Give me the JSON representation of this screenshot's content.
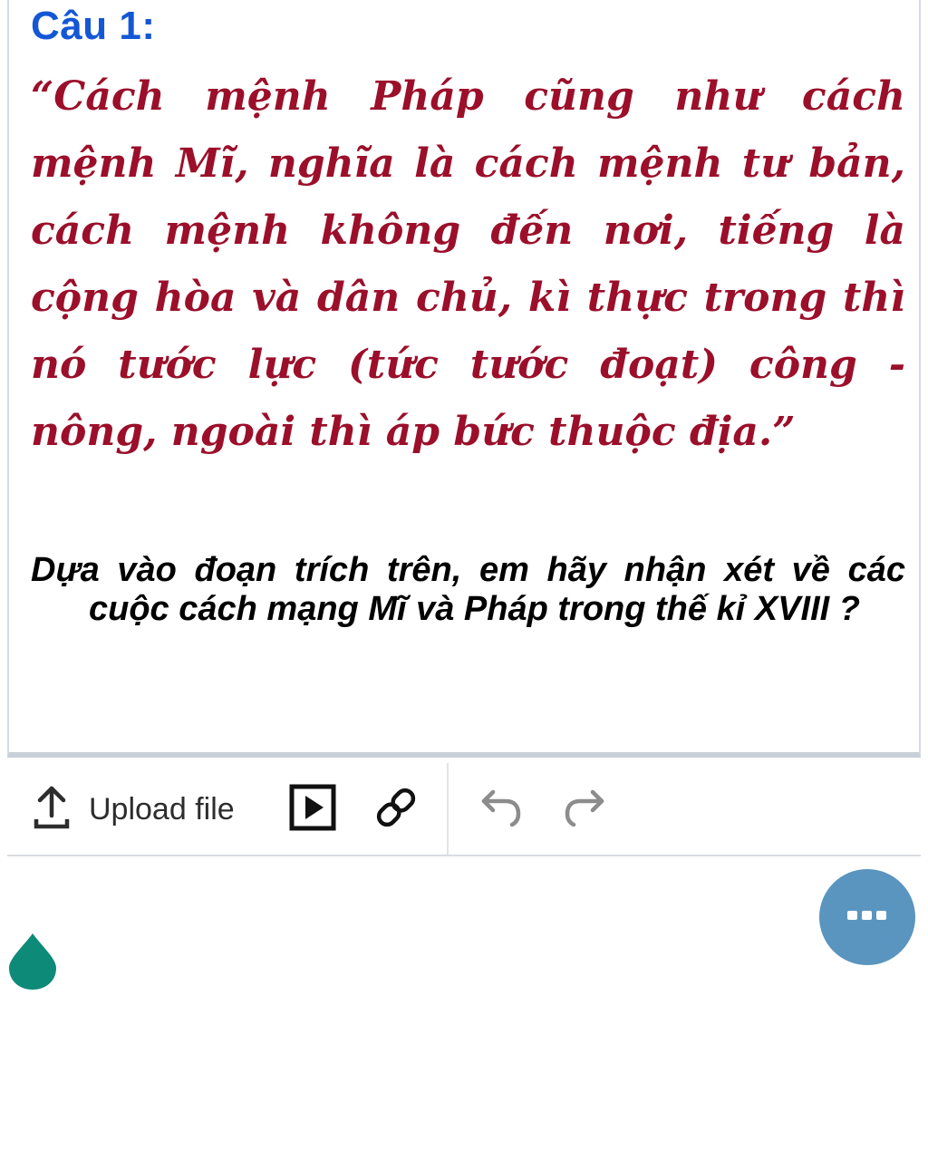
{
  "question": {
    "title": "Câu 1:",
    "quote": "“Cách mệnh Pháp cũng như cách mệnh Mĩ, nghĩa là cách mệnh tư bản, cách mệnh không đến nơi, tiếng là cộng hòa và dân chủ, kì thực trong thì nó tước lực (tức tước đoạt) công - nông, ngoài thì áp bức thuộc địa.”",
    "prompt": "Dựa vào đoạn trích trên, em hãy nhận xét về các cuộc cách mạng Mĩ và Pháp trong thế kỉ XVIII ?"
  },
  "toolbar": {
    "upload_label": "Upload file",
    "icons": [
      "upload-icon",
      "video-icon",
      "link-icon",
      "undo-icon",
      "redo-icon"
    ]
  },
  "floating": {
    "more_button_icon": "more-dots-icon",
    "marker_icon": "drop-icon"
  },
  "colors": {
    "title": "#1457d6",
    "quote": "#9b0f2a",
    "prompt": "#000000",
    "more_button": "#5a95bf",
    "marker": "#0e8a78"
  }
}
